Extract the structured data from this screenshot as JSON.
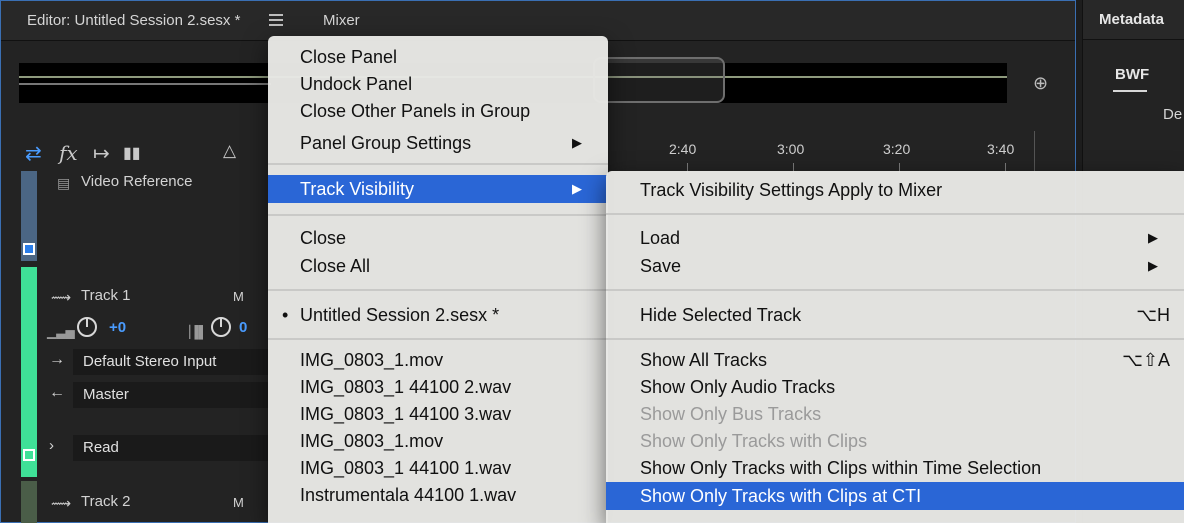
{
  "editor": {
    "tab_editor": "Editor: Untitled Session 2.sesx *",
    "tab_mixer": "Mixer",
    "ruler_labels": [
      "2:40",
      "3:00",
      "3:20",
      "3:40"
    ]
  },
  "tracks": {
    "video_reference": "Video Reference",
    "track1": {
      "name": "Track 1",
      "mute": "M",
      "volume": "+0",
      "pan": "0",
      "input": "Default Stereo Input",
      "output": "Master",
      "automation": "Read"
    },
    "track2": {
      "name": "Track 2",
      "mute": "M"
    }
  },
  "right_panel": {
    "tab": "Metadata",
    "subtab": "BWF",
    "partial_text": "De"
  },
  "menu_main": {
    "items": [
      {
        "label": "Close Panel"
      },
      {
        "label": "Undock Panel"
      },
      {
        "label": "Close Other Panels in Group"
      },
      {
        "label": "Panel Group Settings",
        "arrow": "▶"
      },
      {
        "label": "Track Visibility",
        "arrow": "▶",
        "highlighted": true
      },
      {
        "label": "Close"
      },
      {
        "label": "Close All"
      },
      {
        "label": "Untitled Session 2.sesx *",
        "bullet": "•"
      },
      {
        "label": "IMG_0803_1.mov"
      },
      {
        "label": "IMG_0803_1 44100 2.wav"
      },
      {
        "label": "IMG_0803_1 44100 3.wav"
      },
      {
        "label": "IMG_0803_1.mov"
      },
      {
        "label": "IMG_0803_1 44100 1.wav"
      },
      {
        "label": "Instrumentala 44100 1.wav"
      }
    ]
  },
  "menu_sub": {
    "items": [
      {
        "label": "Track Visibility Settings Apply to Mixer"
      },
      {
        "label": "Load",
        "arrow": "▶"
      },
      {
        "label": "Save",
        "arrow": "▶"
      },
      {
        "label": "Hide Selected Track",
        "shortcut": "⌥H"
      },
      {
        "label": "Show All Tracks",
        "shortcut": "⌥⇧A"
      },
      {
        "label": "Show Only Audio Tracks"
      },
      {
        "label": "Show Only Bus Tracks",
        "disabled": true
      },
      {
        "label": "Show Only Tracks with Clips",
        "disabled": true
      },
      {
        "label": "Show Only Tracks with Clips within Time Selection"
      },
      {
        "label": "Show Only Tracks with Clips at CTI",
        "highlighted": true
      }
    ]
  },
  "colors": {
    "accent": "#2a66d6",
    "track1_strip": "#3fe097",
    "video_strip": "#4b6684",
    "knob_value": "#4a9cff"
  }
}
